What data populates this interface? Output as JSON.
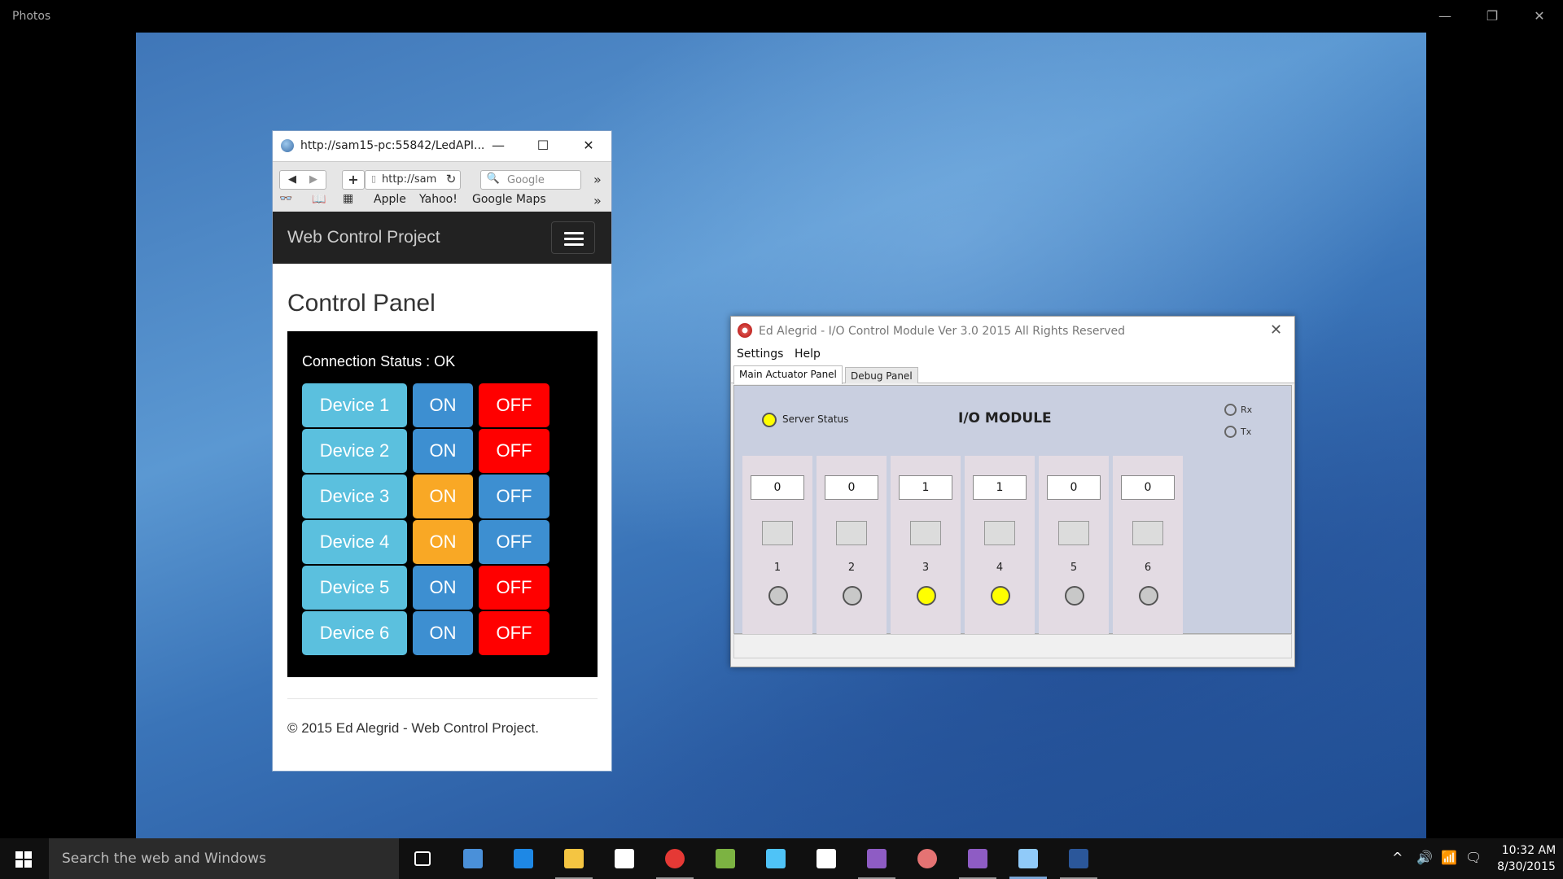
{
  "photos": {
    "title": "Photos",
    "minimize": "—",
    "restore": "❐",
    "close": "✕"
  },
  "browser": {
    "title": "http://sam15-pc:55842/LedAPI...",
    "minimize": "—",
    "maximize": "☐",
    "close": "✕",
    "url": "http://sam",
    "search_placeholder": "Google",
    "bookmarks": [
      "Apple",
      "Yahoo!",
      "Google Maps"
    ],
    "overflow": "»"
  },
  "site": {
    "brand": "Web Control Project",
    "page_title": "Control Panel",
    "connection_status": "Connection Status : OK",
    "on_label": "ON",
    "off_label": "OFF",
    "devices": [
      {
        "name": "Device 1",
        "state": "off"
      },
      {
        "name": "Device 2",
        "state": "off"
      },
      {
        "name": "Device 3",
        "state": "on"
      },
      {
        "name": "Device 4",
        "state": "on"
      },
      {
        "name": "Device 5",
        "state": "off"
      },
      {
        "name": "Device 6",
        "state": "off"
      }
    ],
    "footer": "© 2015 Ed Alegrid - Web Control Project."
  },
  "colors": {
    "on_active": "#f9a825",
    "off_active": "#ff0000",
    "neutral_blue": "#3d8fd1",
    "device_blue": "#5bc0de",
    "led_on": "#ffff00",
    "led_off": "#c8c8c8"
  },
  "iomodule": {
    "title": "Ed Alegrid - I/O Control Module Ver 3.0 2015  All Rights Reserved",
    "close": "✕",
    "menu": [
      "Settings",
      "Help"
    ],
    "tabs": [
      "Main Actuator Panel",
      "Debug Panel"
    ],
    "server_status_label": "Server Status",
    "module_title": "I/O MODULE",
    "rx_label": "Rx",
    "tx_label": "Tx",
    "channels": [
      {
        "num": "1",
        "value": "0",
        "led": "off"
      },
      {
        "num": "2",
        "value": "0",
        "led": "off"
      },
      {
        "num": "3",
        "value": "1",
        "led": "on"
      },
      {
        "num": "4",
        "value": "1",
        "led": "on"
      },
      {
        "num": "5",
        "value": "0",
        "led": "off"
      },
      {
        "num": "6",
        "value": "0",
        "led": "off"
      }
    ]
  },
  "taskbar": {
    "search_placeholder": "Search the web and Windows",
    "apps": [
      {
        "name": "task-view-icon",
        "color": "#ffffff"
      },
      {
        "name": "remote-desktop-icon",
        "color": "#4a90d9"
      },
      {
        "name": "edge-icon",
        "color": "#1e88e5"
      },
      {
        "name": "file-explorer-icon",
        "color": "#f4c542"
      },
      {
        "name": "store-icon",
        "color": "#ffffff"
      },
      {
        "name": "chrome-icon",
        "color": "#e53935"
      },
      {
        "name": "notepad-plus-icon",
        "color": "#7cb342"
      },
      {
        "name": "azure-storage-icon",
        "color": "#4fc3f7"
      },
      {
        "name": "photos-icon",
        "color": "#ffffff"
      },
      {
        "name": "visual-studio-icon",
        "color": "#8e5cc4"
      },
      {
        "name": "settings-gear-icon",
        "color": "#e57373"
      },
      {
        "name": "visual-studio-2-icon",
        "color": "#8e5cc4"
      },
      {
        "name": "safari-icon",
        "color": "#90caf9"
      },
      {
        "name": "word-icon",
        "color": "#2b579a"
      }
    ],
    "time": "10:32 AM",
    "date": "8/30/2015"
  }
}
